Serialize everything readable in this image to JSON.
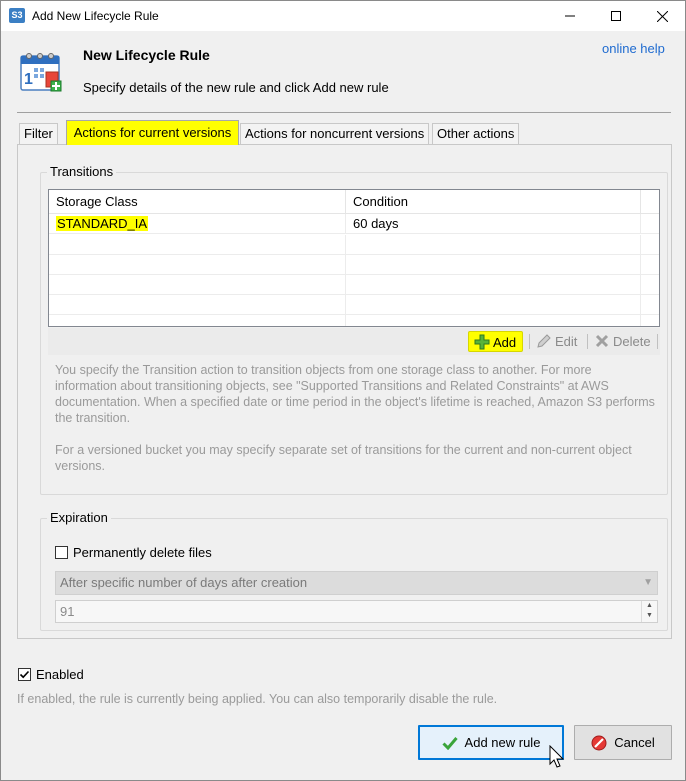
{
  "window": {
    "title": "Add New Lifecycle Rule",
    "app_icon_text": "S3"
  },
  "header": {
    "title": "New Lifecycle Rule",
    "subtitle": "Specify details of the new rule and click Add new rule",
    "help_link": "online help"
  },
  "tabs": [
    {
      "label": "Filter",
      "selected": false
    },
    {
      "label": "Actions for current versions",
      "selected": true
    },
    {
      "label": "Actions for noncurrent versions",
      "selected": false
    },
    {
      "label": "Other actions",
      "selected": false
    }
  ],
  "transitions": {
    "group_title": "Transitions",
    "columns": [
      "Storage Class",
      "Condition"
    ],
    "rows": [
      {
        "storage_class": "STANDARD_IA",
        "condition": "60 days"
      }
    ],
    "toolbar": {
      "add": "Add",
      "edit": "Edit",
      "delete": "Delete"
    },
    "help_paragraph_1": "You specify the Transition action to transition objects from one storage class to another. For more information about transitioning objects, see \"Supported Transitions and Related Constraints\" at AWS documentation. When a specified date or time period in the object's lifetime is reached, Amazon S3 performs the transition.",
    "help_paragraph_2": "For a versioned bucket you may specify separate set of transitions for the current and non-current object versions."
  },
  "expiration": {
    "group_title": "Expiration",
    "permanently_delete_label": "Permanently delete files",
    "permanently_delete_checked": false,
    "mode_selected": "After specific number of days after creation",
    "days_value": "91"
  },
  "enabled": {
    "label": "Enabled",
    "checked": true,
    "note": "If enabled, the rule is currently being applied. You can also temporarily disable the rule."
  },
  "buttons": {
    "add_rule": "Add new rule",
    "cancel": "Cancel"
  },
  "colors": {
    "highlight": "#ffff00",
    "link": "#1f6bd0",
    "focus_border": "#0078d7"
  }
}
